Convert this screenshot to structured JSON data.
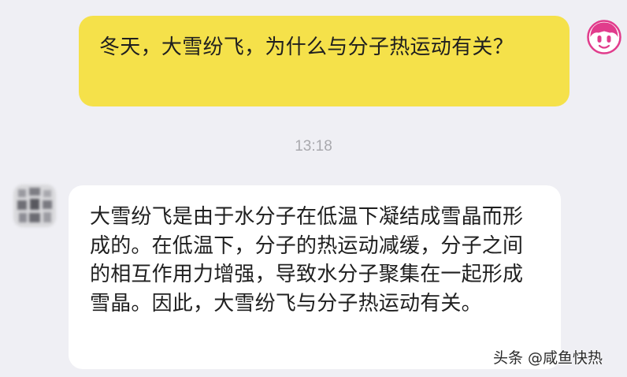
{
  "messages": {
    "user": {
      "text": "冬天，大雪纷飞，为什么与分子热运动有关？"
    },
    "timestamp": "13:18",
    "assistant": {
      "text": "大雪纷飞是由于水分子在低温下凝结成雪晶而形成的。在低温下，分子的热运动减缓，分子之间的相互作用力增强，导致水分子聚集在一起形成雪晶。因此，大雪纷飞与分子热运动有关。"
    }
  },
  "watermark": "头条 @咸鱼快热",
  "colors": {
    "background": "#efeff4",
    "user_bubble": "#f5e14a",
    "assistant_bubble": "#ffffff",
    "avatar_pink": "#e13c8c",
    "timestamp": "#a9a9ae"
  },
  "icons": {
    "user_avatar": "cartoon-face-avatar",
    "assistant_avatar": "blurred-avatar"
  }
}
